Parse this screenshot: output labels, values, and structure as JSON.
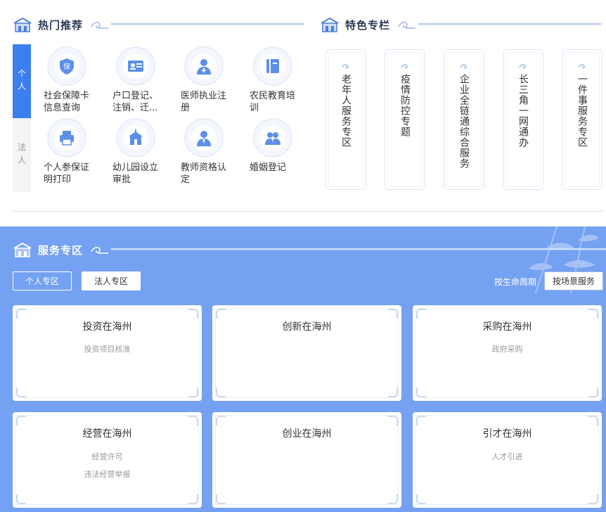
{
  "hot": {
    "title": "热门推荐",
    "tabs": [
      "个人",
      "法人"
    ],
    "items": [
      {
        "label": "社会保障卡信息查询",
        "icon": "shield-icon"
      },
      {
        "label": "户口登记、注销、迁...",
        "icon": "id-card-icon"
      },
      {
        "label": "医师执业注册",
        "icon": "doctor-icon"
      },
      {
        "label": "农民教育培训",
        "icon": "book-icon"
      },
      {
        "label": "个人参保证明打印",
        "icon": "printer-icon"
      },
      {
        "label": "幼儿园设立审批",
        "icon": "school-icon"
      },
      {
        "label": "教师资格认定",
        "icon": "teacher-icon"
      },
      {
        "label": "婚姻登记",
        "icon": "couple-icon"
      }
    ]
  },
  "featured": {
    "title": "特色专栏",
    "columns": [
      "老年人服务专区",
      "疫情防控专题",
      "企业全链通综合服务",
      "长三角一网通办",
      "一件事服务专区"
    ]
  },
  "service": {
    "title": "服务专区",
    "tab_personal": "个人专区",
    "tab_corporate": "法人专区",
    "by_lifecycle": "按生命周期",
    "by_scene": "按场景服务",
    "cards": [
      {
        "title": "投资在海州",
        "links": [
          "投资项目核准"
        ]
      },
      {
        "title": "创新在海州",
        "links": []
      },
      {
        "title": "采购在海州",
        "links": [
          "政府采购"
        ]
      },
      {
        "title": "经营在海州",
        "links": [
          "经营许可",
          "违法经营举报"
        ]
      },
      {
        "title": "创业在海州",
        "links": []
      },
      {
        "title": "引才在海州",
        "links": [
          "人才引进"
        ]
      }
    ]
  },
  "colors": {
    "accent": "#3b7ef0",
    "service_bg": "#75a1f2",
    "icon": "#5b8fe8"
  }
}
